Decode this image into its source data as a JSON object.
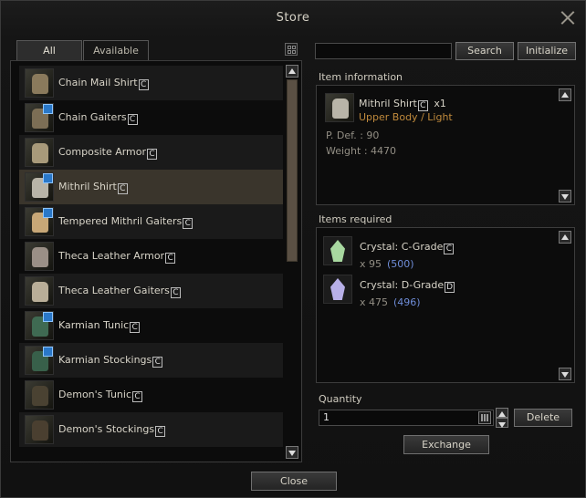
{
  "window": {
    "title": "Store"
  },
  "tabs": [
    {
      "label": "All"
    },
    {
      "label": "Available"
    }
  ],
  "search": {
    "value": "",
    "button": "Search",
    "initialize": "Initialize"
  },
  "items": [
    {
      "name": "Chain Mail Shirt",
      "grade": "C",
      "icon": "chain-mail-shirt-icon",
      "color": "#8a7a5c"
    },
    {
      "name": "Chain Gaiters",
      "grade": "C",
      "icon": "chain-gaiters-icon",
      "color": "#7c6e55",
      "badge": true
    },
    {
      "name": "Composite Armor",
      "grade": "C",
      "icon": "composite-armor-icon",
      "color": "#a89a7a"
    },
    {
      "name": "Mithril Shirt",
      "grade": "C",
      "icon": "mithril-shirt-icon",
      "color": "#b8b4a8",
      "badge": true
    },
    {
      "name": "Tempered Mithril Gaiters",
      "grade": "C",
      "icon": "tempered-mithril-gaiters-icon",
      "color": "#c7a777",
      "badge": true
    },
    {
      "name": "Theca Leather Armor",
      "grade": "C",
      "icon": "theca-leather-armor-icon",
      "color": "#9a8f86"
    },
    {
      "name": "Theca Leather Gaiters",
      "grade": "C",
      "icon": "theca-leather-gaiters-icon",
      "color": "#b9ae98"
    },
    {
      "name": "Karmian Tunic",
      "grade": "C",
      "icon": "karmian-tunic-icon",
      "color": "#3f6a52",
      "badge": true
    },
    {
      "name": "Karmian Stockings",
      "grade": "C",
      "icon": "karmian-stockings-icon",
      "color": "#38604a",
      "badge": true
    },
    {
      "name": "Demon's Tunic",
      "grade": "C",
      "icon": "demons-tunic-icon",
      "color": "#4a4232"
    },
    {
      "name": "Demon's Stockings",
      "grade": "C",
      "icon": "demons-stockings-icon",
      "color": "#4a3f30"
    }
  ],
  "list_scroll": {
    "position": 0.12
  },
  "item_info": {
    "label": "Item information",
    "name": "Mithril Shirt",
    "grade": "C",
    "count": "x1",
    "type": "Upper Body / Light",
    "pdef": "P. Def. : 90",
    "weight": "Weight : 4470"
  },
  "required": {
    "label": "Items required",
    "items": [
      {
        "name": "Crystal: C-Grade",
        "grade": "C",
        "count": "x 95",
        "have": "(500)",
        "icon": "crystal-c-grade-icon",
        "color": "#a8d8a0"
      },
      {
        "name": "Crystal: D-Grade",
        "grade": "D",
        "count": "x 475",
        "have": "(496)",
        "icon": "crystal-d-grade-icon",
        "color": "#b8b0e8"
      }
    ]
  },
  "quantity": {
    "label": "Quantity",
    "value": "1",
    "delete": "Delete"
  },
  "exchange": "Exchange",
  "close": "Close"
}
